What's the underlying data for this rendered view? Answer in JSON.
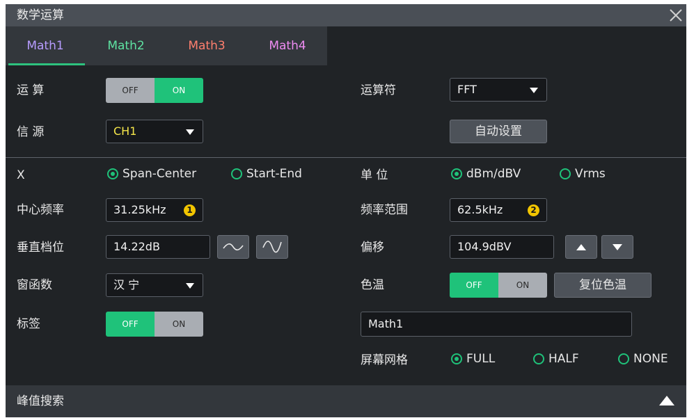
{
  "title": "数学运算",
  "tabs": [
    {
      "label": "Math1",
      "color": "#b79cff"
    },
    {
      "label": "Math2",
      "color": "#5ee3a2"
    },
    {
      "label": "Math3",
      "color": "#ff7f6e"
    },
    {
      "label": "Math4",
      "color": "#ee8cf2"
    }
  ],
  "active_tab": "Math1",
  "operation": {
    "label": "运 算",
    "off": "OFF",
    "on": "ON",
    "state": "ON"
  },
  "operator": {
    "label": "运算符",
    "value": "FFT"
  },
  "source": {
    "label": "信 源",
    "value": "CH1",
    "value_color": "#f5e64a"
  },
  "auto_set": {
    "label": "自动设置"
  },
  "x_axis": {
    "label": "X",
    "options": [
      "Span-Center",
      "Start-End"
    ],
    "selected": "Span-Center"
  },
  "unit": {
    "label": "单 位",
    "options": [
      "dBm/dBV",
      "Vrms"
    ],
    "selected": "dBm/dBV"
  },
  "center_freq": {
    "label": "中心频率",
    "value": "31.25kHz",
    "badge": "1"
  },
  "freq_span": {
    "label": "频率范围",
    "value": "62.5kHz",
    "badge": "2"
  },
  "vertical_scale": {
    "label": "垂直档位",
    "value": "14.22dB"
  },
  "offset": {
    "label": "偏移",
    "value": "104.9dBV"
  },
  "window": {
    "label": "窗函数",
    "value": "汉 宁"
  },
  "color_grade": {
    "label": "色温",
    "off": "OFF",
    "on": "ON",
    "state": "OFF",
    "reset_label": "复位色温"
  },
  "tag": {
    "label": "标签",
    "off": "OFF",
    "on": "ON",
    "state": "OFF",
    "value": "Math1"
  },
  "grid": {
    "label": "屏幕网格",
    "options": [
      "FULL",
      "HALF",
      "NONE"
    ],
    "selected": "FULL"
  },
  "peak_search": {
    "label": "峰值搜索"
  },
  "colors": {
    "accent": "#1fc27a",
    "badge": "#f2c500"
  }
}
